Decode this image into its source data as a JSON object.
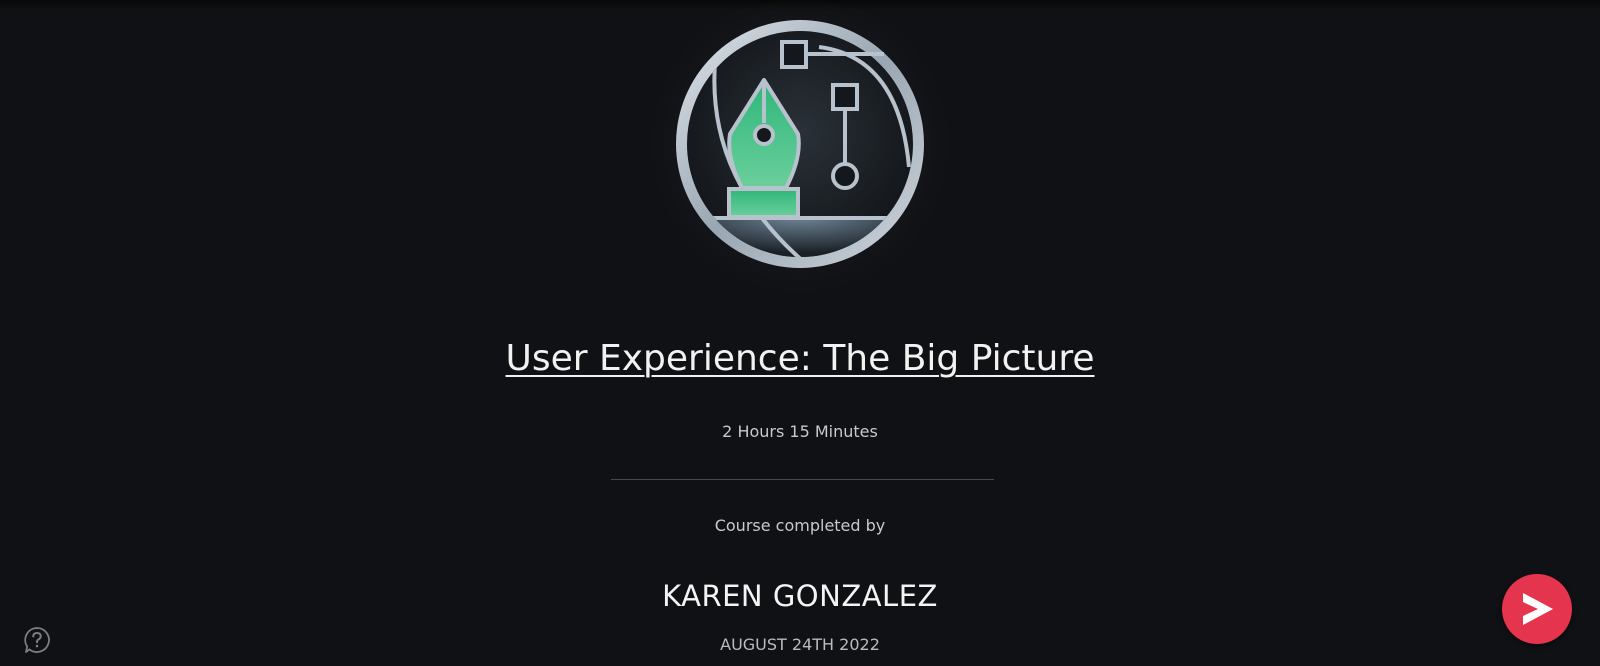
{
  "course": {
    "title": "User Experience: The Big Picture",
    "duration": "2 Hours 15 Minutes"
  },
  "certificate": {
    "completed_label": "Course completed by",
    "learner_name": "KAREN GONZALEZ",
    "completion_date": "AUGUST 24TH 2022"
  },
  "icons": {
    "badge": "pen-tool-badge-icon",
    "help": "help-chat-icon",
    "fab": "play-arrow-icon"
  },
  "colors": {
    "background": "#101114",
    "accent": "#e5344d",
    "badge_green": "#3dbb85",
    "badge_silver": "#b7c2cc"
  }
}
